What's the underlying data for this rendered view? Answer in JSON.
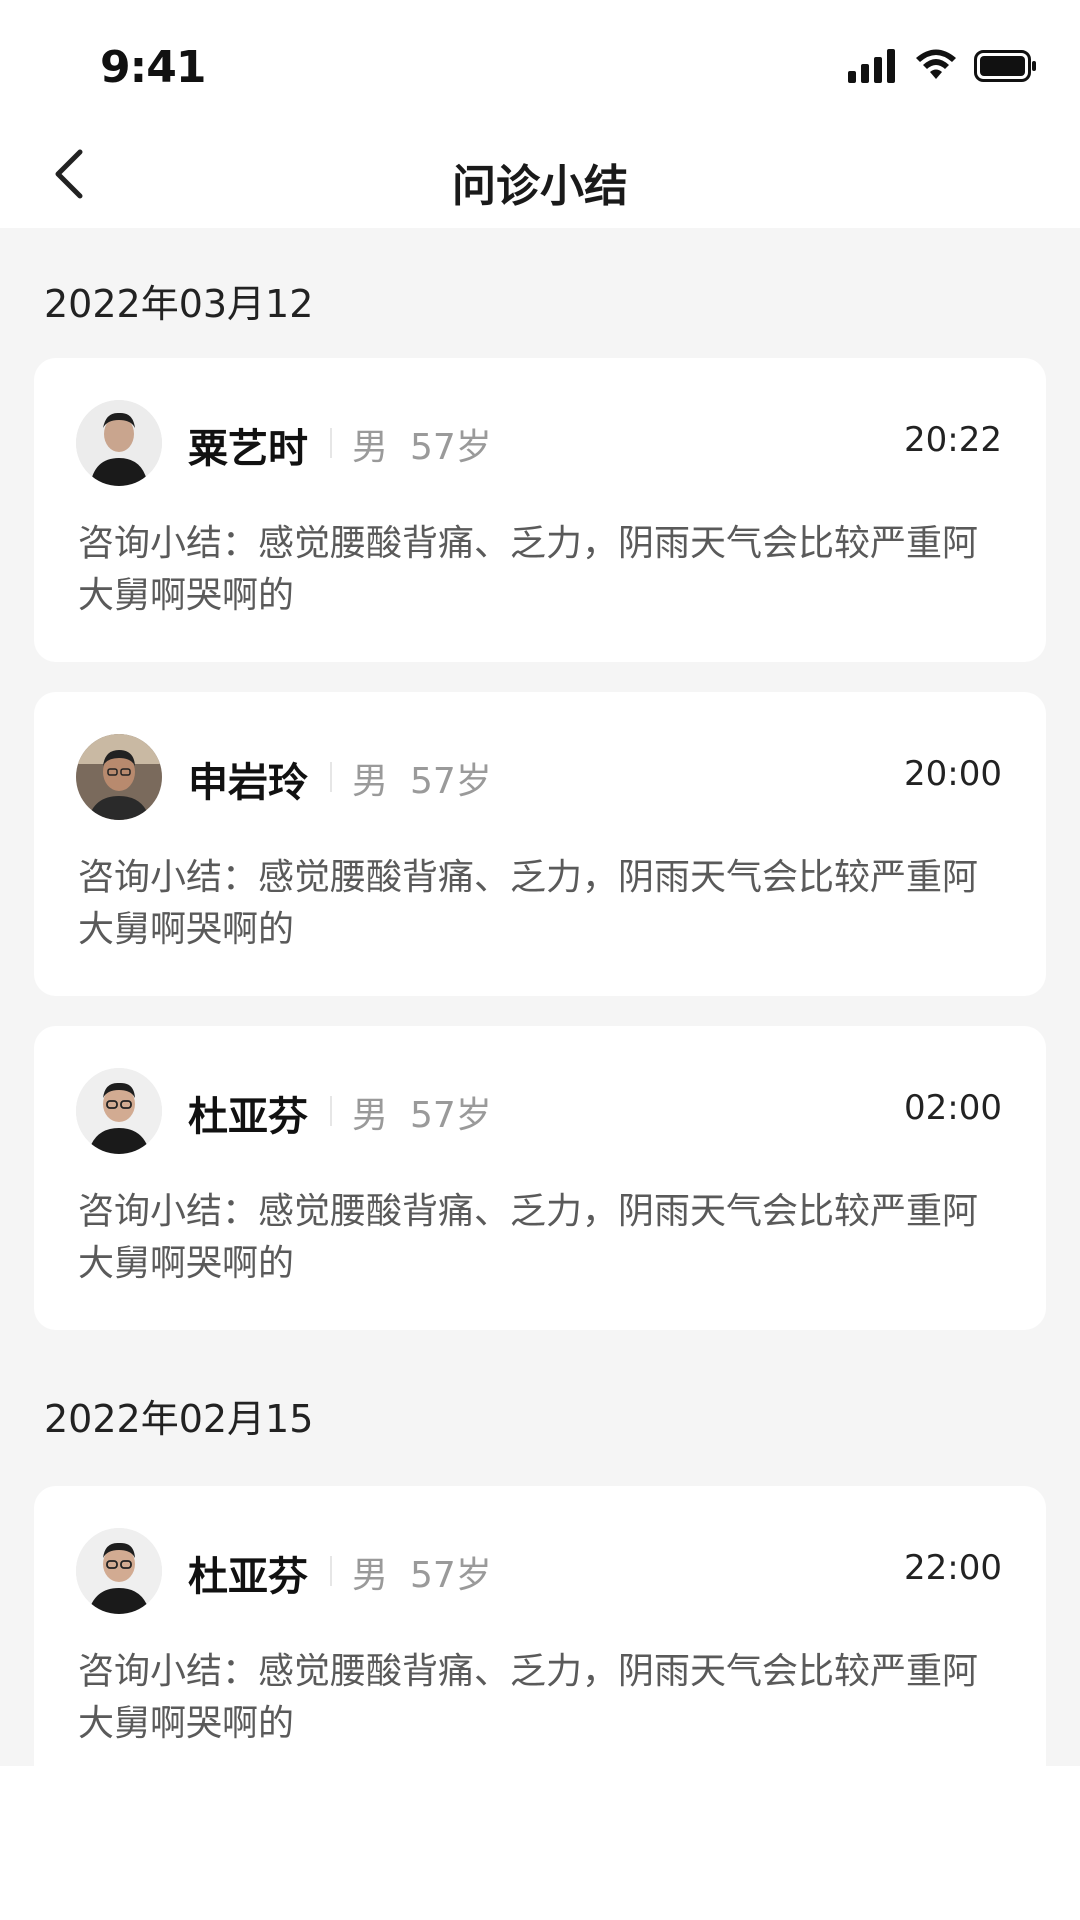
{
  "status_bar": {
    "time": "9:41",
    "icons": [
      "signal-icon",
      "wifi-icon",
      "battery-icon"
    ]
  },
  "nav": {
    "title": "问诊小结",
    "back_icon": "chevron-left-icon"
  },
  "groups": [
    {
      "date": "2022年03月12",
      "records": [
        {
          "name": "粟艺时",
          "gender": "男",
          "age": "57岁",
          "time": "20:22",
          "summary": "咨询小结：感觉腰酸背痛、乏力，阴雨天气会比较严重阿大舅啊哭啊的"
        },
        {
          "name": "申岩玲",
          "gender": "男",
          "age": "57岁",
          "time": "20:00",
          "summary": "咨询小结：感觉腰酸背痛、乏力，阴雨天气会比较严重阿大舅啊哭啊的"
        },
        {
          "name": "杜亚芬",
          "gender": "男",
          "age": "57岁",
          "time": "02:00",
          "summary": "咨询小结：感觉腰酸背痛、乏力，阴雨天气会比较严重阿大舅啊哭啊的"
        }
      ]
    },
    {
      "date": "2022年02月15",
      "records": [
        {
          "name": "杜亚芬",
          "gender": "男",
          "age": "57岁",
          "time": "22:00",
          "summary": "咨询小结：感觉腰酸背痛、乏力，阴雨天气会比较严重阿大舅啊哭啊的"
        }
      ]
    }
  ],
  "colors": {
    "page_bg": "#f5f5f5",
    "card_bg": "#ffffff",
    "muted_text": "#9a9a9a"
  }
}
